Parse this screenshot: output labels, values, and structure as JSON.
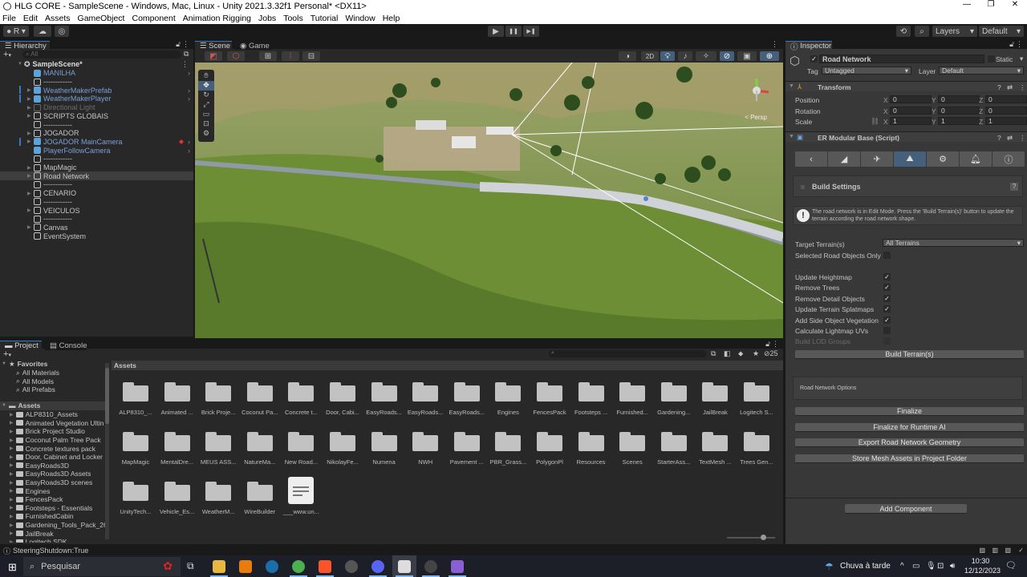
{
  "window": {
    "title": "HLG CORE - SampleScene - Windows, Mac, Linux - Unity 2021.3.32f1 Personal* <DX11>",
    "controls": {
      "minimize": "—",
      "maximize": "❐",
      "close": "✕"
    }
  },
  "menu": [
    "File",
    "Edit",
    "Assets",
    "GameObject",
    "Component",
    "Animation Rigging",
    "Jobs",
    "Tools",
    "Tutorial",
    "Window",
    "Help"
  ],
  "toolbar": {
    "account_label": "R",
    "play": "▶",
    "pause": "❚❚",
    "step": "▶❚",
    "layers_label": "Layers",
    "layout_label": "Default"
  },
  "hierarchy": {
    "tab_label": "Hierarchy",
    "search_placeholder": "All",
    "scene_name": "SampleScene*",
    "items": [
      {
        "label": "MANILHA",
        "style": "prefab",
        "expandable": false
      },
      {
        "label": "------------",
        "style": "normal",
        "expandable": false
      },
      {
        "label": "WeatherMakerPrefab",
        "style": "prefab",
        "expandable": true
      },
      {
        "label": "WeatherMakerPlayer",
        "style": "prefab",
        "expandable": true
      },
      {
        "label": "Directional Light",
        "style": "disabled",
        "expandable": true
      },
      {
        "label": "SCRIPTS GLOBAIS",
        "style": "normal",
        "expandable": true
      },
      {
        "label": "------------",
        "style": "normal",
        "expandable": false
      },
      {
        "label": "JOGADOR",
        "style": "normal",
        "expandable": true
      },
      {
        "label": "JOGADOR MainCamera",
        "style": "prefab",
        "expandable": true
      },
      {
        "label": "PlayerFollowCamera",
        "style": "prefab",
        "expandable": false
      },
      {
        "label": "------------",
        "style": "normal",
        "expandable": false
      },
      {
        "label": "MapMagic",
        "style": "normal",
        "expandable": true
      },
      {
        "label": "Road Network",
        "style": "selected",
        "expandable": true
      },
      {
        "label": "------------",
        "style": "normal",
        "expandable": false
      },
      {
        "label": "CENARIO",
        "style": "normal",
        "expandable": true
      },
      {
        "label": "------------",
        "style": "normal",
        "expandable": false
      },
      {
        "label": "VEICULOS",
        "style": "normal",
        "expandable": true
      },
      {
        "label": "------------",
        "style": "normal",
        "expandable": false
      },
      {
        "label": "Canvas",
        "style": "normal",
        "expandable": true
      },
      {
        "label": "EventSystem",
        "style": "normal",
        "expandable": false
      }
    ]
  },
  "scene": {
    "tabs": [
      "Scene",
      "Game"
    ],
    "mode_2d": "2D",
    "persp_label": "< Persp"
  },
  "inspector": {
    "tab_label": "Inspector",
    "object_name": "Road Network",
    "active": true,
    "static_label": "Static",
    "tag_label": "Tag",
    "tag_value": "Untagged",
    "layer_label": "Layer",
    "layer_value": "Default",
    "transform": {
      "title": "Transform",
      "rows": [
        {
          "label": "Position",
          "x": "0",
          "y": "0",
          "z": "0"
        },
        {
          "label": "Rotation",
          "x": "0",
          "y": "0",
          "z": "0"
        },
        {
          "label": "Scale",
          "x": "1",
          "y": "1",
          "z": "1"
        }
      ]
    },
    "script": {
      "title": "ER Modular Base (Script)",
      "tool_icons": [
        "back-arrow",
        "road-add",
        "road-connect",
        "terrain-build",
        "settings-gear",
        "bell",
        "info"
      ],
      "active_tool_index": 3,
      "section_title": "Build Settings",
      "help_label": "?",
      "warning": "The road network is in Edit Mode. Press the 'Build Terrain(s)' button to update the terrain according the road network shape.",
      "target_terrain_label": "Target Terrain(s)",
      "target_terrain_value": "All Terrains",
      "options": [
        {
          "label": "Selected Road Objects Only",
          "checked": false,
          "disabled": false
        },
        {
          "label": "Update Heightmap",
          "checked": true,
          "disabled": false
        },
        {
          "label": "Remove Trees",
          "checked": true,
          "disabled": false
        },
        {
          "label": "Remove Detail Objects",
          "checked": true,
          "disabled": false
        },
        {
          "label": "Update Terrain Splatmaps",
          "checked": true,
          "disabled": false
        },
        {
          "label": "Add Side Object Vegetation",
          "checked": true,
          "disabled": false
        },
        {
          "label": "Calculate Lightmap UVs",
          "checked": false,
          "disabled": false
        },
        {
          "label": "Build LOD Groups",
          "checked": false,
          "disabled": true
        }
      ],
      "build_button": "Build Terrain(s)",
      "road_options_label": "Road Network Options",
      "actions": [
        "Finalize",
        "Finalize for Runtime AI",
        "Export Road Network Geometry",
        "Store Mesh Assets in Project Folder"
      ]
    },
    "add_component": "Add Component"
  },
  "project": {
    "tabs": [
      "Project",
      "Console"
    ],
    "hidden_count": "25",
    "favorites_label": "Favorites",
    "favorites": [
      "All Materials",
      "All Models",
      "All Prefabs"
    ],
    "assets_label": "Assets",
    "tree": [
      "ALP8310_Assets",
      "Animated Vegetation Ultin",
      "Brick Project Studio",
      "Coconut Palm Tree Pack",
      "Concrete textures pack",
      "Door, Cabinet and Locker",
      "EasyRoads3D",
      "EasyRoads3D Assets",
      "EasyRoads3D scenes",
      "Engines",
      "FencesPack",
      "Footsteps - Essentials",
      "FurnishedCabin",
      "Gardening_Tools_Pack_26",
      "JailBreak",
      "Logitech SDK"
    ],
    "breadcrumb": "Assets",
    "grid": [
      {
        "label": "ALP8310_...",
        "type": "folder"
      },
      {
        "label": "Animated ...",
        "type": "folder"
      },
      {
        "label": "Brick Proje...",
        "type": "folder"
      },
      {
        "label": "Coconut Pa...",
        "type": "folder"
      },
      {
        "label": "Concrete t...",
        "type": "folder"
      },
      {
        "label": "Door, Cabi...",
        "type": "folder"
      },
      {
        "label": "EasyRoads...",
        "type": "folder"
      },
      {
        "label": "EasyRoads...",
        "type": "folder"
      },
      {
        "label": "EasyRoads...",
        "type": "folder"
      },
      {
        "label": "Engines",
        "type": "folder"
      },
      {
        "label": "FencesPack",
        "type": "folder"
      },
      {
        "label": "Footsteps ...",
        "type": "folder"
      },
      {
        "label": "Furnished...",
        "type": "folder"
      },
      {
        "label": "Gardening...",
        "type": "folder"
      },
      {
        "label": "JailBreak",
        "type": "folder"
      },
      {
        "label": "Logitech S...",
        "type": "folder"
      },
      {
        "label": "MapMagic",
        "type": "folder"
      },
      {
        "label": "MentalDre...",
        "type": "folder"
      },
      {
        "label": "MEUS ASS...",
        "type": "folder"
      },
      {
        "label": "NatureMa...",
        "type": "folder"
      },
      {
        "label": "New Road...",
        "type": "folder"
      },
      {
        "label": "NikolayFe...",
        "type": "folder"
      },
      {
        "label": "Numena",
        "type": "folder"
      },
      {
        "label": "NWH",
        "type": "folder"
      },
      {
        "label": "Pavement ...",
        "type": "folder"
      },
      {
        "label": "PBR_Grass...",
        "type": "folder"
      },
      {
        "label": "PolygonPl",
        "type": "folder"
      },
      {
        "label": "Resources",
        "type": "folder"
      },
      {
        "label": "Scenes",
        "type": "folder"
      },
      {
        "label": "StarterAss...",
        "type": "folder"
      },
      {
        "label": "TextMesh ...",
        "type": "folder"
      },
      {
        "label": "Trees Gen...",
        "type": "folder"
      },
      {
        "label": "UnityTech...",
        "type": "folder"
      },
      {
        "label": "Vehicle_Es...",
        "type": "folder"
      },
      {
        "label": "WeatherM...",
        "type": "folder"
      },
      {
        "label": "WireBuilder",
        "type": "folder"
      },
      {
        "label": "___www.un...",
        "type": "file"
      }
    ]
  },
  "status": {
    "message": "SteeringShutdown:True"
  },
  "taskbar": {
    "search_placeholder": "Pesquisar",
    "weather": "Chuva à tarde",
    "time": "10:30",
    "date": "12/12/2023",
    "apps": [
      "file-explorer",
      "blender",
      "steam",
      "chrome",
      "brave",
      "media-player",
      "discord",
      "unity",
      "davinci-resolve",
      "visual-studio"
    ],
    "active_app": "unity"
  },
  "colors": {
    "accent": "#3a79bb",
    "prefab_text": "#7a9fd8",
    "selected_tool": "#46607c"
  }
}
